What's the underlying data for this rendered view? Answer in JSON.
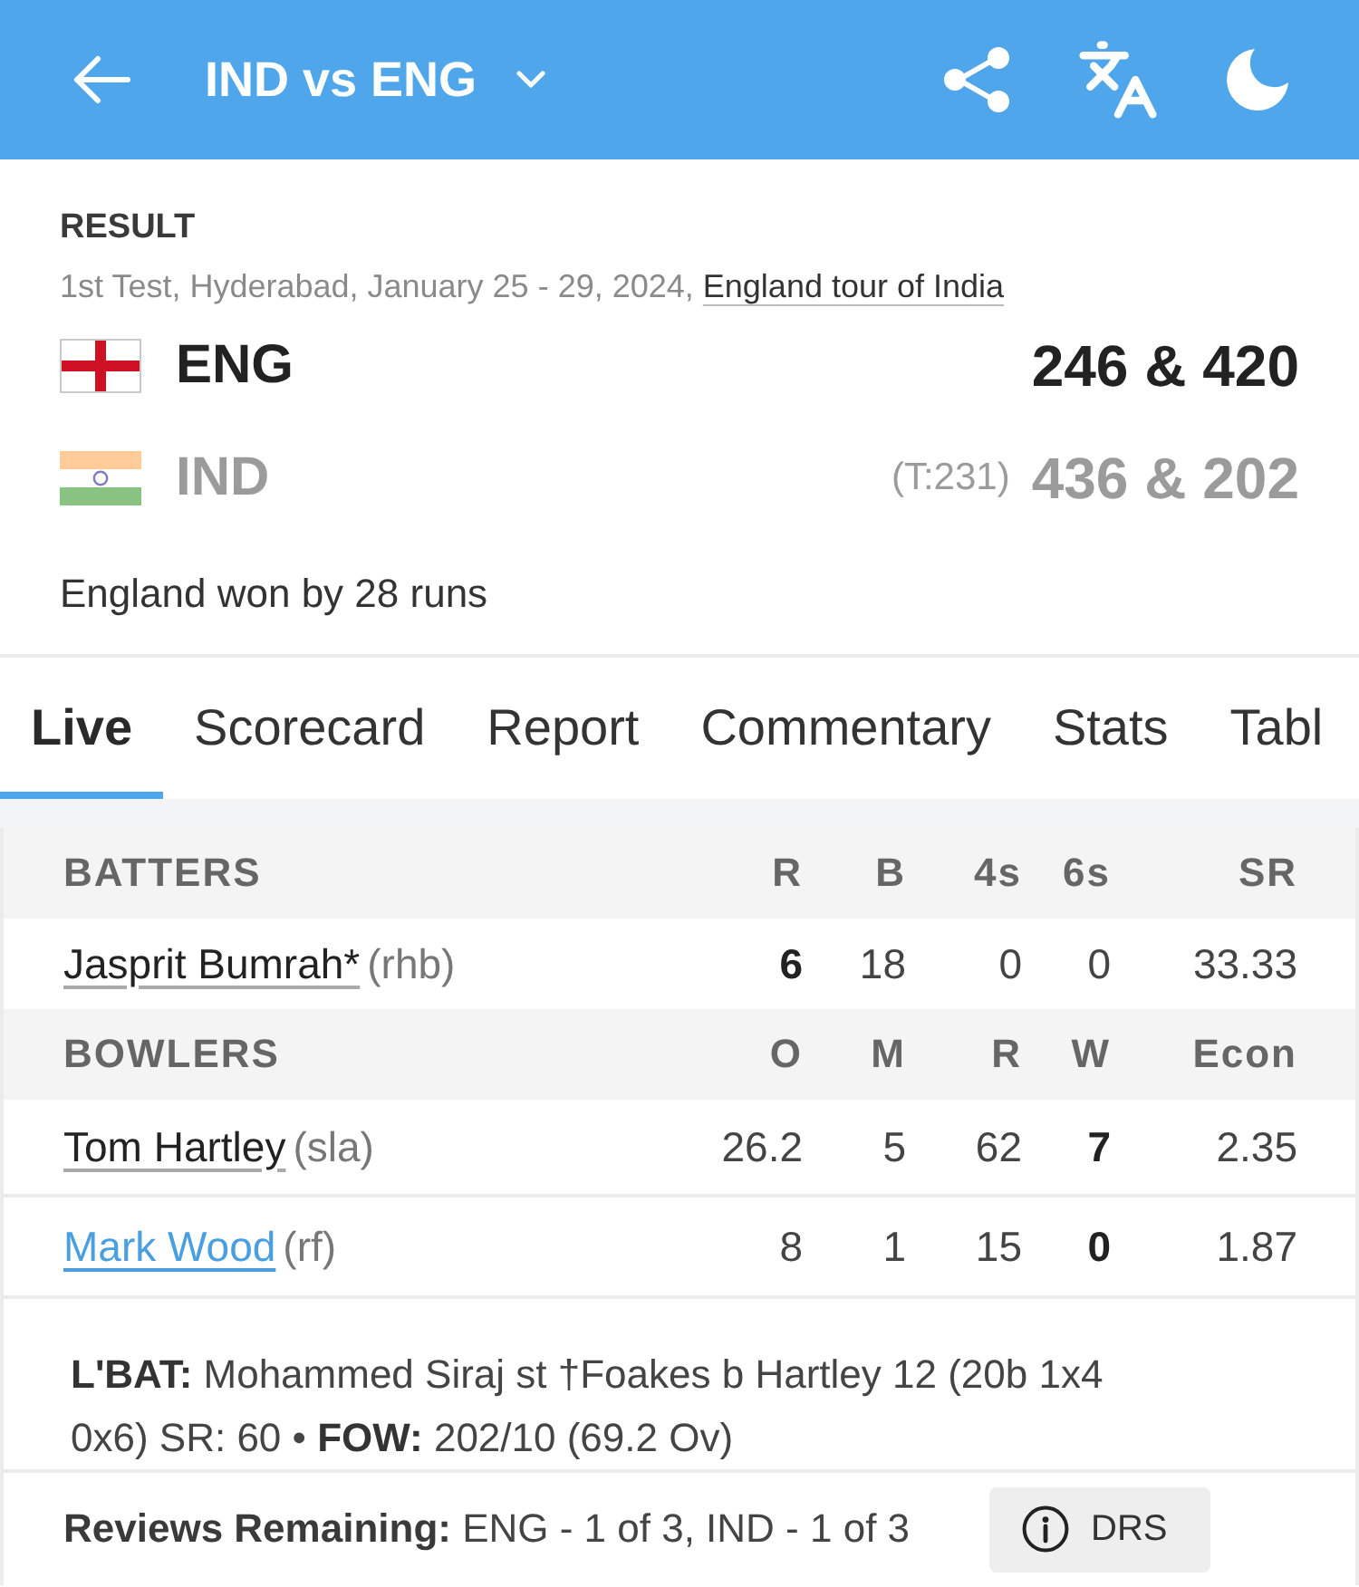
{
  "header": {
    "title": "IND vs ENG"
  },
  "match": {
    "status": "RESULT",
    "details": "1st Test, Hyderabad, January 25 - 29, 2024,",
    "series": "England tour of India",
    "teams": [
      {
        "kind": "england",
        "name": "ENG",
        "score": "246 & 420",
        "winner": true
      },
      {
        "kind": "india",
        "name": "IND",
        "target": "(T:231)",
        "score": "436 & 202",
        "winner": false
      }
    ],
    "result": "England won by 28 runs"
  },
  "tabs": [
    {
      "label": "Live",
      "selected": true
    },
    {
      "label": "Scorecard",
      "selected": false
    },
    {
      "label": "Report",
      "selected": false
    },
    {
      "label": "Commentary",
      "selected": false
    },
    {
      "label": "Stats",
      "selected": false
    },
    {
      "label": "Tabl",
      "selected": false
    }
  ],
  "sections": [
    {
      "title": "BATTERS",
      "columns": [
        {
          "label": "R",
          "emphasis": true
        },
        {
          "label": "B",
          "emphasis": false
        },
        {
          "label": "4s",
          "emphasis": false
        },
        {
          "label": "6s",
          "emphasis": false
        },
        {
          "label": "SR",
          "emphasis": false
        }
      ],
      "rows": [
        {
          "name": "Jasprit Bumrah*",
          "style": "(rhb)",
          "highlighted": false,
          "values": [
            "6",
            "18",
            "0",
            "0",
            "33.33"
          ]
        }
      ]
    },
    {
      "title": "BOWLERS",
      "columns": [
        {
          "label": "O",
          "emphasis": false
        },
        {
          "label": "M",
          "emphasis": false
        },
        {
          "label": "R",
          "emphasis": false
        },
        {
          "label": "W",
          "emphasis": true
        },
        {
          "label": "Econ",
          "emphasis": false
        }
      ],
      "rows": [
        {
          "name": "Tom Hartley",
          "style": "(sla)",
          "highlighted": false,
          "values": [
            "26.2",
            "5",
            "62",
            "7",
            "2.35"
          ]
        },
        {
          "name": "Mark Wood",
          "style": "(rf)",
          "highlighted": true,
          "values": [
            "8",
            "1",
            "15",
            "0",
            "1.87"
          ]
        }
      ]
    }
  ],
  "last_batter": "**L'BAT:** Mohammed Siraj st †Foakes b Hartley 12 (20b 1x4 0x6) SR: 60 • **FOW:** 202/10 (69.2 Ov)",
  "reviews": {
    "text": "**Reviews Remaining:** ENG - 1 of 3, IND - 1 of 3",
    "button": "DRS"
  }
}
